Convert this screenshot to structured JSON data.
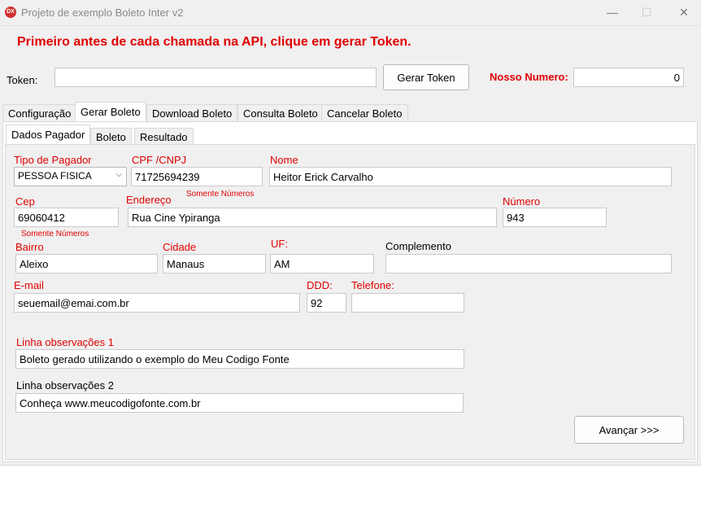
{
  "window": {
    "title": "Projeto de exemplo Boleto Inter v2",
    "icon_text": "DX",
    "minimize_glyph": "—",
    "maximize_glyph": "☐",
    "close_glyph": "✕"
  },
  "instruction": "Primeiro antes de cada chamada na API, clique em gerar Token.",
  "token": {
    "label": "Token:",
    "value": "",
    "button_label": "Gerar Token"
  },
  "nosso_numero": {
    "label": "Nosso Numero:",
    "value": "0"
  },
  "main_tabs": [
    {
      "label": "Configuração",
      "active": false
    },
    {
      "label": "Gerar Boleto",
      "active": true
    },
    {
      "label": "Download Boleto",
      "active": false
    },
    {
      "label": "Consulta Boleto",
      "active": false
    },
    {
      "label": "Cancelar Boleto",
      "active": false
    }
  ],
  "sub_tabs": [
    {
      "label": "Dados Pagador",
      "active": true
    },
    {
      "label": "Boleto",
      "active": false
    },
    {
      "label": "Resultado",
      "active": false
    }
  ],
  "form": {
    "tipo_pagador": {
      "label": "Tipo de Pagador",
      "value": "PESSOA FISICA"
    },
    "cpf_cnpj": {
      "label": "CPF /CNPJ",
      "value": "71725694239",
      "hint": "Somente Números"
    },
    "nome": {
      "label": "Nome",
      "value": "Heitor Erick Carvalho"
    },
    "cep": {
      "label": "Cep",
      "value": "69060412",
      "hint": "Somente Números"
    },
    "endereco": {
      "label": "Endereço",
      "value": "Rua Cine Ypiranga"
    },
    "numero": {
      "label": "Número",
      "value": "943"
    },
    "bairro": {
      "label": "Bairro",
      "value": "Aleixo"
    },
    "cidade": {
      "label": "Cidade",
      "value": "Manaus"
    },
    "uf": {
      "label": "UF:",
      "value": "AM"
    },
    "complemento": {
      "label": "Complemento",
      "value": ""
    },
    "email": {
      "label": "E-mail",
      "value": "seuemail@emai.com.br"
    },
    "ddd": {
      "label": "DDD:",
      "value": "92"
    },
    "telefone": {
      "label": "Telefone:",
      "value": ""
    },
    "obs1": {
      "label": "Linha observações 1",
      "value": "Boleto gerado utilizando o exemplo do Meu Codigo Fonte"
    },
    "obs2": {
      "label": "Linha observações 2",
      "value": "Conheça www.meucodigofonte.com.br"
    }
  },
  "avancar_label": "Avançar >>>",
  "colors": {
    "accent_red": "#e00000",
    "background": "#f0f0f0",
    "field_border": "#c9c9c9"
  }
}
